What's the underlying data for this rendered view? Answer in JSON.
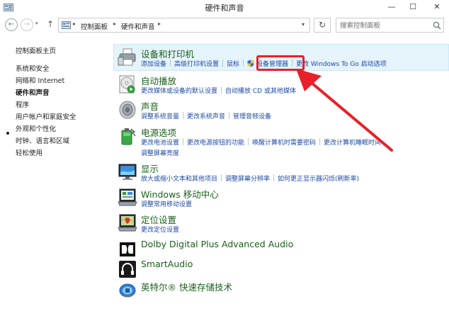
{
  "window": {
    "title": "硬件和声音",
    "minimize_glyph": "—",
    "maximize_glyph": "☐",
    "close_glyph": "✕"
  },
  "addressbar": {
    "back_glyph": "←",
    "forward_glyph": "→",
    "recent_glyph": "▾",
    "up_glyph": "↑",
    "breadcrumbs": [
      "控制面板",
      "硬件和声音"
    ],
    "crumb_sep_glyph": "▸",
    "dropdown_glyph": "▾",
    "refresh_glyph": "↻",
    "search_placeholder": "搜索控制面板"
  },
  "sidebar": {
    "items": [
      {
        "label": "控制面板主页",
        "active": false
      },
      {
        "label": "系统和安全",
        "active": false
      },
      {
        "label": "网络和 Internet",
        "active": false
      },
      {
        "label": "硬件和声音",
        "active": true
      },
      {
        "label": "程序",
        "active": false
      },
      {
        "label": "用户帐户和家庭安全",
        "active": false
      },
      {
        "label": "外观和个性化",
        "active": false
      },
      {
        "label": "时钟、语言和区域",
        "active": false
      },
      {
        "label": "轻松使用",
        "active": false
      }
    ]
  },
  "categories": [
    {
      "title": "设备和打印机",
      "icon": "printer-icon",
      "links": [
        "添加设备",
        "高级打印机设置",
        "鼠标",
        "设备管理器",
        "更改 Windows To Go 启动选项"
      ],
      "links2": []
    },
    {
      "title": "自动播放",
      "icon": "autoplay-icon",
      "links": [
        "更改媒体或设备的默认设置",
        "自动播放 CD 或其他媒体"
      ],
      "links2": []
    },
    {
      "title": "声音",
      "icon": "speaker-icon",
      "links": [
        "调整系统音量",
        "更改系统声音",
        "管理音频设备"
      ],
      "links2": []
    },
    {
      "title": "电源选项",
      "icon": "battery-icon",
      "links": [
        "更改电池设置",
        "更改电源按钮的功能",
        "唤醒计算机时需要密码",
        "更改计算机睡眠时间"
      ],
      "links2": [
        "调整屏幕亮度"
      ]
    },
    {
      "title": "显示",
      "icon": "display-icon",
      "links": [
        "放大或缩小文本和其他项目",
        "调整屏幕分辨率",
        "如何更正显示器闪烁(刷新率)"
      ],
      "links2": []
    },
    {
      "title": "Windows 移动中心",
      "icon": "mobility-center-icon",
      "links": [
        "调整常用移动设置"
      ],
      "links2": []
    },
    {
      "title": "定位设置",
      "icon": "location-icon",
      "links": [
        "更改定位设置"
      ],
      "links2": []
    },
    {
      "title": "Dolby Digital Plus Advanced Audio",
      "icon": "dolby-icon",
      "links": [],
      "links2": []
    },
    {
      "title": "SmartAudio",
      "icon": "headphones-icon",
      "links": [],
      "links2": []
    },
    {
      "title": "英特尔® 快速存储技术",
      "icon": "intel-storage-icon",
      "links": [],
      "links2": []
    }
  ],
  "colors": {
    "category_title": "#1a5e1a",
    "link": "#1f4aa3",
    "highlight_bg": "#e5f3fb",
    "annotation_red": "#e8202a"
  }
}
